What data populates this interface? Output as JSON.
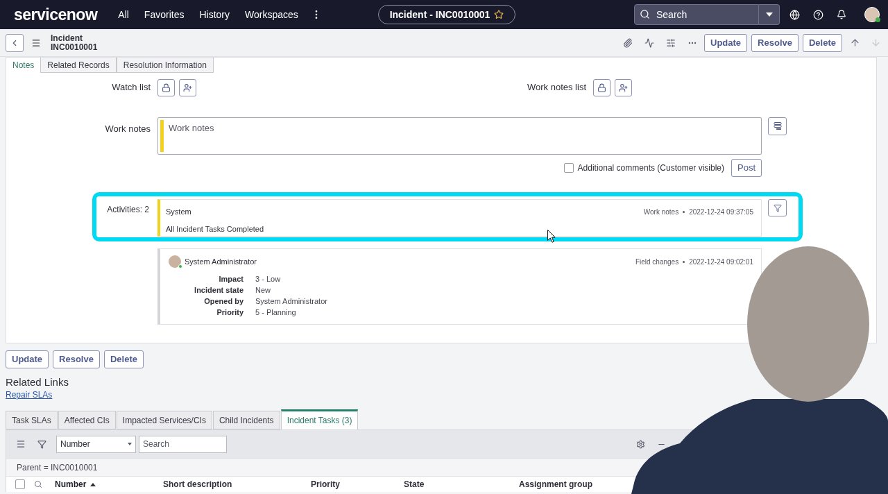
{
  "top_nav": {
    "logo": "servicenow",
    "menu": [
      "All",
      "Favorites",
      "History",
      "Workspaces"
    ],
    "record_pill": {
      "title": "Incident - INC0010001",
      "starred": false
    },
    "search": {
      "placeholder": "Search"
    },
    "user": {
      "online": true
    }
  },
  "form_header": {
    "title": "Incident",
    "number": "INC0010001",
    "buttons": [
      "Update",
      "Resolve",
      "Delete"
    ],
    "nav_arrows": [
      {
        "kind": "up",
        "disabled": false
      },
      {
        "kind": "down",
        "disabled": true
      }
    ]
  },
  "section_tabs": [
    {
      "label": "Notes",
      "selected": true
    },
    {
      "label": "Related Records",
      "selected": false
    },
    {
      "label": "Resolution Information",
      "selected": false
    }
  ],
  "notes": {
    "watch_list_label": "Watch list",
    "work_notes_list_label": "Work notes list",
    "work_notes": {
      "label": "Work notes",
      "placeholder": "Work notes"
    },
    "additional_comments": {
      "label": "Additional comments (Customer visible)",
      "checked": false
    },
    "post_button": "Post"
  },
  "activities": {
    "label": "Activities: 2",
    "entries": [
      {
        "kind": "work_note",
        "highlighted": true,
        "author": "System",
        "type": "Work notes",
        "time": "2022-12-24 09:37:05",
        "text": "All Incident Tasks Completed"
      },
      {
        "kind": "field_changes",
        "highlighted": false,
        "online": true,
        "author": "System Administrator",
        "type": "Field changes",
        "time": "2022-12-24 09:02:01",
        "fields": [
          {
            "label": "Impact",
            "value": "3 - Low"
          },
          {
            "label": "Incident state",
            "value": "New"
          },
          {
            "label": "Opened by",
            "value": "System Administrator"
          },
          {
            "label": "Priority",
            "value": "5 - Planning"
          }
        ]
      }
    ]
  },
  "bottom_buttons": [
    "Update",
    "Resolve",
    "Delete"
  ],
  "related_links": {
    "title": "Related Links",
    "links": [
      "Repair SLAs"
    ]
  },
  "related_tabs": [
    {
      "label": "Task SLAs",
      "selected": false
    },
    {
      "label": "Affected CIs",
      "selected": false
    },
    {
      "label": "Impacted Services/CIs",
      "selected": false
    },
    {
      "label": "Child Incidents",
      "selected": false
    },
    {
      "label": "Incident Tasks (3)",
      "selected": true
    }
  ],
  "related_list": {
    "search_column": "Number",
    "search": {
      "placeholder": "Search"
    },
    "filter_text": "Parent = INC0010001",
    "select_all_checked": false,
    "columns": [
      {
        "label": "Number",
        "sorted_ascending": true
      },
      {
        "label": "Short description",
        "sorted_ascending": false
      },
      {
        "label": "Priority",
        "sorted_ascending": false
      },
      {
        "label": "State",
        "sorted_ascending": false
      },
      {
        "label": "Assignment group",
        "sorted_ascending": false
      }
    ]
  }
}
